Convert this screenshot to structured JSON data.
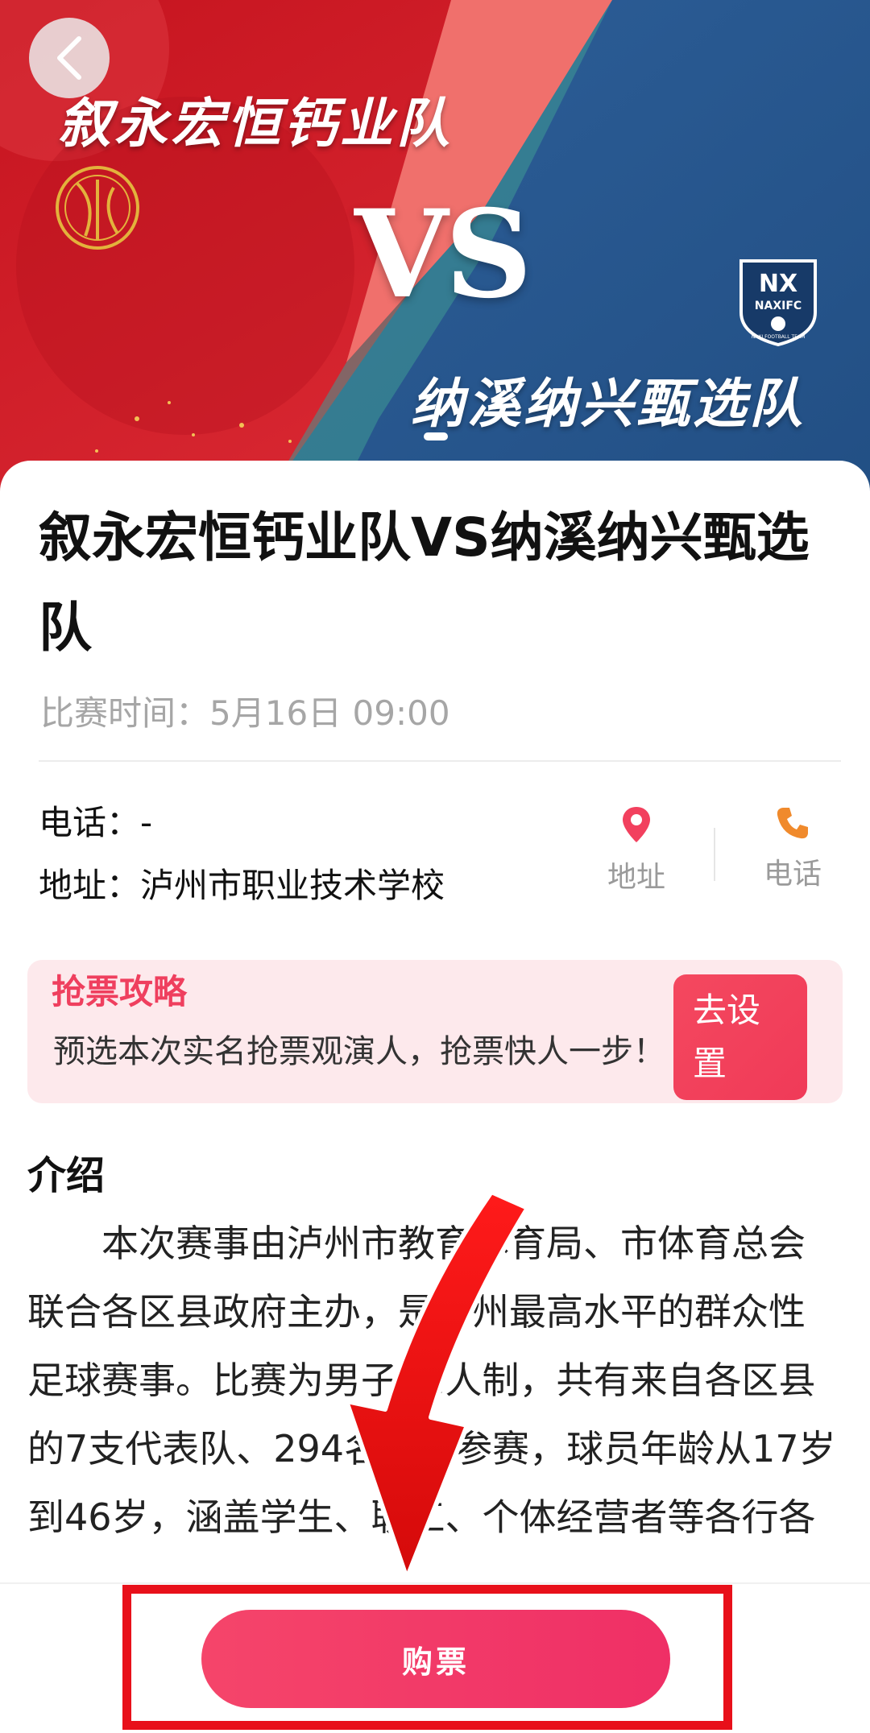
{
  "banner": {
    "team1": "叙永宏恒钙业队",
    "vs": "VS",
    "team2": "纳溪纳兴甄选队",
    "logo2_text": "NX",
    "logo2_sub": "NAXIFC",
    "logo2_small": "NAXI FOOTBALL TEAM",
    "colors": {
      "red": "#d1202c",
      "blue": "#27578f",
      "coral": "#f06d6b"
    }
  },
  "event": {
    "title": "叙永宏恒钙业队VS纳溪纳兴甄选队",
    "time_label": "比赛时间：",
    "time_value": "5月16日 09:00",
    "phone_label": "电话：",
    "phone_value": "-",
    "address_label": "地址：",
    "address_value": "泸州市职业技术学校"
  },
  "actions": {
    "address": "地址",
    "phone": "电话"
  },
  "tips": {
    "title": "抢票攻略",
    "text": "预选本次实名抢票观演人，抢票快人一步！",
    "button": "去设置"
  },
  "intro": {
    "title": "介绍",
    "text": "本次赛事由泸州市教育体育局、市体育总会联合各区县政府主办，是泸州最高水平的群众性足球赛事。比赛为男子11人制，共有来自各区县的7支代表队、294名球员参赛，球员年龄从17岁到46岁，涵盖学生、职工、个体经营者等各行各业。"
  },
  "bottom": {
    "buy_button": "购票",
    "highlight_color": "#e8101a"
  }
}
